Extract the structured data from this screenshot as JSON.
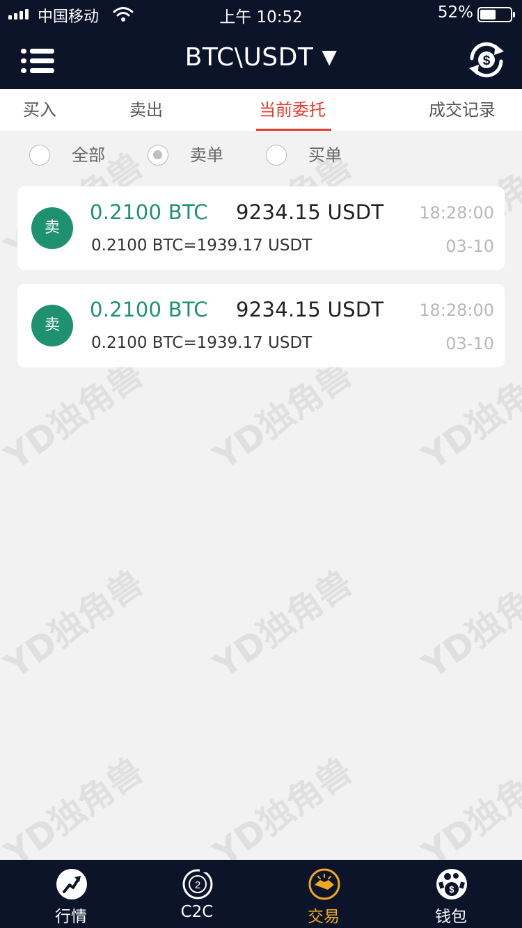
{
  "status_bar": {
    "carrier": "中国移动",
    "time": "上午 10:52",
    "battery_percent": "52%",
    "battery_level": 0.52
  },
  "header": {
    "pair": "BTC\\USDT",
    "caret": "▼",
    "menu_icon": "list-menu-icon",
    "right_icon": "currency-exchange-icon"
  },
  "tabs": [
    {
      "label": "买入",
      "active": false
    },
    {
      "label": "卖出",
      "active": false
    },
    {
      "label": "当前委托",
      "active": true
    },
    {
      "label": "成交记录",
      "active": false
    }
  ],
  "filters": [
    {
      "label": "全部",
      "checked": false
    },
    {
      "label": "卖单",
      "checked": true
    },
    {
      "label": "买单",
      "checked": false
    }
  ],
  "orders": [
    {
      "badge": "卖",
      "amount": "0.2100  BTC",
      "price": "9234.15  USDT",
      "time": "18:28:00",
      "rate": "0.2100  BTC=1939.17  USDT",
      "date": "03-10"
    },
    {
      "badge": "卖",
      "amount": "0.2100  BTC",
      "price": "9234.15  USDT",
      "time": "18:28:00",
      "rate": "0.2100  BTC=1939.17  USDT",
      "date": "03-10"
    }
  ],
  "watermark": "YD独角兽",
  "bottom_nav": [
    {
      "label": "行情",
      "icon": "market-trend-icon",
      "active": false
    },
    {
      "label": "C2C",
      "icon": "c2c-icon",
      "active": false
    },
    {
      "label": "交易",
      "icon": "trade-handshake-icon",
      "active": true
    },
    {
      "label": "钱包",
      "icon": "wallet-money-icon",
      "active": false
    }
  ],
  "colors": {
    "dark_bg": "#0b1429",
    "accent_red": "#e53a2e",
    "green": "#1e9171",
    "active_nav": "#f0a81e"
  }
}
